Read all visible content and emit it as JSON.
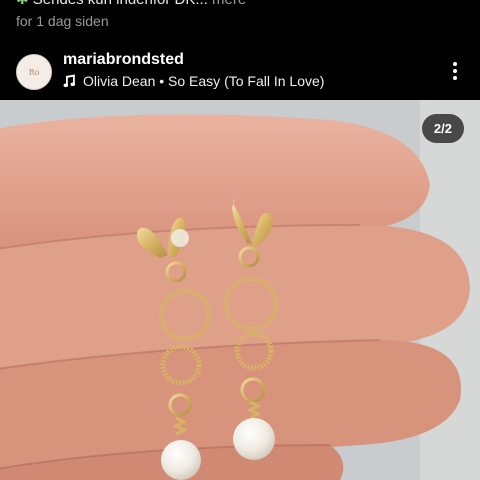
{
  "previous_post": {
    "caption_text": "Sendes kun indenfor DK...",
    "more_label": "mere",
    "time": "for 1 dag siden"
  },
  "post": {
    "username": "mariabrondsted",
    "avatar_text": "Ro",
    "audio": "Olivia Dean • So Easy (To Fall In Love)",
    "carousel_counter": "2/2"
  },
  "colors": {
    "background": "#000000",
    "muted_text": "#9a9a9a",
    "leaf_emoji": "#7bd36b",
    "skin": "#e3a58f",
    "gold": "#d9b86a",
    "pearl": "#f4f1ec"
  },
  "icons": [
    "leaf-emoji-icon",
    "music-note-icon",
    "more-vert-icon"
  ]
}
